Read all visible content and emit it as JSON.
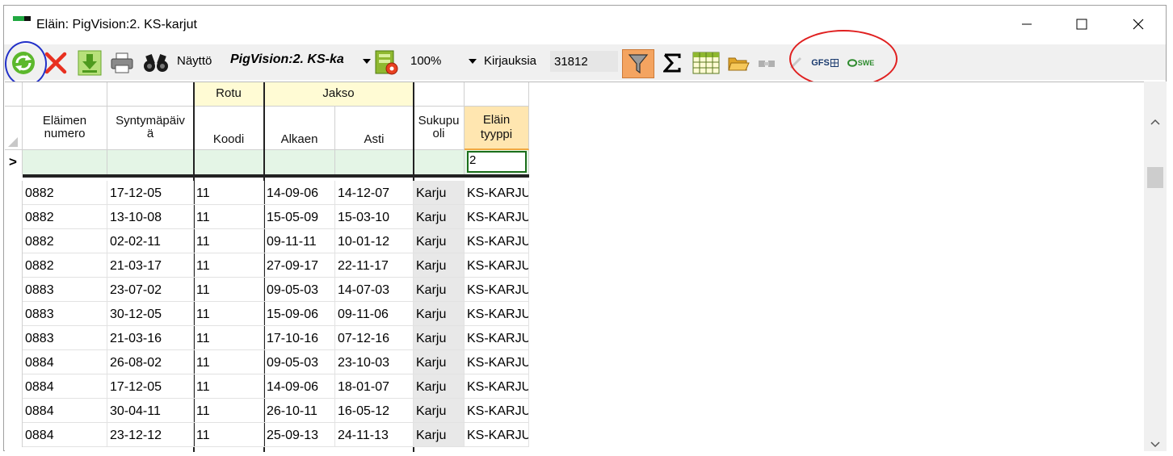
{
  "window": {
    "title": "Eläin: PigVision:2. KS-karjut"
  },
  "toolbar": {
    "nayto_label": "Näyttö",
    "view_combo_value": "PigVision:2. KS-ka",
    "zoom_value": "100%",
    "records_label": "Kirjauksia",
    "records_count": "31812",
    "gfs_label": "GFS",
    "swe_label": "SWE"
  },
  "grid": {
    "group_headers": {
      "rotu": "Rotu",
      "jakso": "Jakso"
    },
    "columns": {
      "elaimen_numero": "Eläimen numero",
      "syntymapaiva_1": "Syntymäpäiv",
      "syntymapaiva_2": "ä",
      "koodi": "Koodi",
      "alkaen": "Alkaen",
      "asti": "Asti",
      "sukupuoli_1": "Sukupu",
      "sukupuoli_2": "oli",
      "elaintyyppi_1": "Eläin",
      "elaintyyppi_2": "tyyppi"
    },
    "filter": {
      "row_marker": ">",
      "elaintyyppi_value": "2"
    },
    "rows": [
      [
        "0882",
        "17-12-05",
        "11",
        "14-09-06",
        "14-12-07",
        "Karju",
        "KS-KARJU"
      ],
      [
        "0882",
        "13-10-08",
        "11",
        "15-05-09",
        "15-03-10",
        "Karju",
        "KS-KARJU"
      ],
      [
        "0882",
        "02-02-11",
        "11",
        "09-11-11",
        "10-01-12",
        "Karju",
        "KS-KARJU"
      ],
      [
        "0882",
        "21-03-17",
        "11",
        "27-09-17",
        "22-11-17",
        "Karju",
        "KS-KARJU"
      ],
      [
        "0883",
        "23-07-02",
        "11",
        "09-05-03",
        "14-07-03",
        "Karju",
        "KS-KARJU"
      ],
      [
        "0883",
        "30-12-05",
        "11",
        "15-09-06",
        "09-11-06",
        "Karju",
        "KS-KARJU"
      ],
      [
        "0883",
        "21-03-16",
        "11",
        "17-10-16",
        "07-12-16",
        "Karju",
        "KS-KARJU"
      ],
      [
        "0884",
        "26-08-02",
        "11",
        "09-05-03",
        "23-10-03",
        "Karju",
        "KS-KARJU"
      ],
      [
        "0884",
        "17-12-05",
        "11",
        "14-09-06",
        "18-01-07",
        "Karju",
        "KS-KARJU"
      ],
      [
        "0884",
        "30-04-11",
        "11",
        "26-10-11",
        "16-05-12",
        "Karju",
        "KS-KARJU"
      ],
      [
        "0884",
        "23-12-12",
        "11",
        "25-09-13",
        "24-11-13",
        "Karju",
        "KS-KARJU"
      ]
    ]
  },
  "colors": {
    "group_header_bg": "#fffbd4",
    "filter_row_bg": "#e4f5e6",
    "active_col_header_bg": "#ffe6b0",
    "sukupuoli_col_bg": "#e8e8e8",
    "filter_button_bg": "#f4a460",
    "annotation_blue": "#2230c8",
    "annotation_red": "#e02020"
  }
}
